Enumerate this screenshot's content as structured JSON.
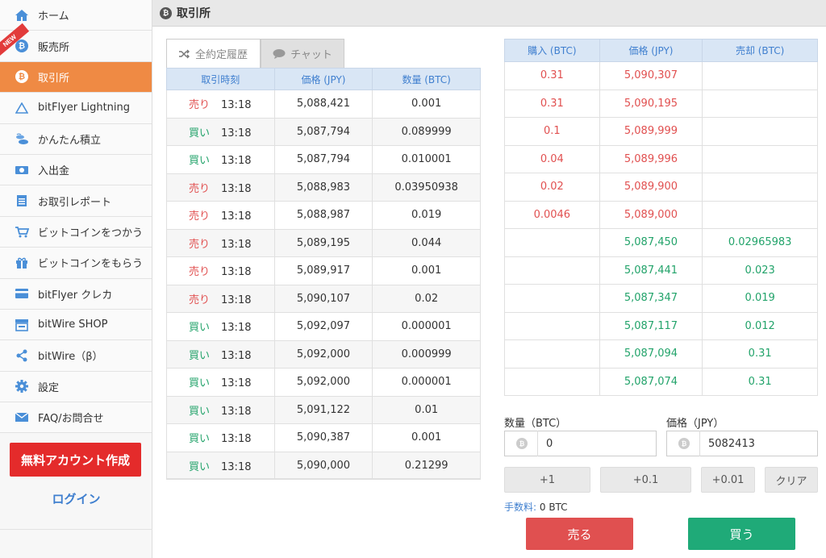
{
  "sidebar": {
    "new_badge": "NEW",
    "items": [
      {
        "label": "ホーム",
        "icon": "home-icon"
      },
      {
        "label": "販売所",
        "icon": "bitcoin-icon"
      },
      {
        "label": "取引所",
        "icon": "bitcoin-icon"
      },
      {
        "label": "bitFlyer Lightning",
        "icon": "lightning-icon"
      },
      {
        "label": "かんたん積立",
        "icon": "coins-icon"
      },
      {
        "label": "入出金",
        "icon": "money-icon"
      },
      {
        "label": "お取引レポート",
        "icon": "report-icon"
      },
      {
        "label": "ビットコインをつかう",
        "icon": "cart-icon"
      },
      {
        "label": "ビットコインをもらう",
        "icon": "gift-icon"
      },
      {
        "label": "bitFlyer クレカ",
        "icon": "card-icon"
      },
      {
        "label": "bitWire SHOP",
        "icon": "shop-icon"
      },
      {
        "label": "bitWire（β）",
        "icon": "share-icon"
      },
      {
        "label": "設定",
        "icon": "gear-icon"
      },
      {
        "label": "FAQ/お問合せ",
        "icon": "mail-icon"
      }
    ],
    "signup_label": "無料アカウント作成",
    "login_label": "ログイン"
  },
  "header": {
    "title": "取引所"
  },
  "tabs": {
    "history": "全約定履歴",
    "chat": "チャット"
  },
  "trades": {
    "headers": [
      "取引時刻",
      "価格 (JPY)",
      "数量 (BTC)"
    ],
    "rows": [
      {
        "side": "売り",
        "type": "sell",
        "time": "13:18",
        "price": "5,088,421",
        "qty": "0.001"
      },
      {
        "side": "買い",
        "type": "buy",
        "time": "13:18",
        "price": "5,087,794",
        "qty": "0.089999"
      },
      {
        "side": "買い",
        "type": "buy",
        "time": "13:18",
        "price": "5,087,794",
        "qty": "0.010001"
      },
      {
        "side": "売り",
        "type": "sell",
        "time": "13:18",
        "price": "5,088,983",
        "qty": "0.03950938"
      },
      {
        "side": "売り",
        "type": "sell",
        "time": "13:18",
        "price": "5,088,987",
        "qty": "0.019"
      },
      {
        "side": "売り",
        "type": "sell",
        "time": "13:18",
        "price": "5,089,195",
        "qty": "0.044"
      },
      {
        "side": "売り",
        "type": "sell",
        "time": "13:18",
        "price": "5,089,917",
        "qty": "0.001"
      },
      {
        "side": "売り",
        "type": "sell",
        "time": "13:18",
        "price": "5,090,107",
        "qty": "0.02"
      },
      {
        "side": "買い",
        "type": "buy",
        "time": "13:18",
        "price": "5,092,097",
        "qty": "0.000001"
      },
      {
        "side": "買い",
        "type": "buy",
        "time": "13:18",
        "price": "5,092,000",
        "qty": "0.000999"
      },
      {
        "side": "買い",
        "type": "buy",
        "time": "13:18",
        "price": "5,092,000",
        "qty": "0.000001"
      },
      {
        "side": "買い",
        "type": "buy",
        "time": "13:18",
        "price": "5,091,122",
        "qty": "0.01"
      },
      {
        "side": "買い",
        "type": "buy",
        "time": "13:18",
        "price": "5,090,387",
        "qty": "0.001"
      },
      {
        "side": "買い",
        "type": "buy",
        "time": "13:18",
        "price": "5,090,000",
        "qty": "0.21299"
      }
    ]
  },
  "orderbook": {
    "headers": [
      "購入 (BTC)",
      "価格 (JPY)",
      "売却 (BTC)"
    ],
    "asks": [
      {
        "buy": "0.31",
        "price": "5,090,307"
      },
      {
        "buy": "0.31",
        "price": "5,090,195"
      },
      {
        "buy": "0.1",
        "price": "5,089,999"
      },
      {
        "buy": "0.04",
        "price": "5,089,996"
      },
      {
        "buy": "0.02",
        "price": "5,089,900"
      },
      {
        "buy": "0.0046",
        "price": "5,089,000"
      }
    ],
    "bids": [
      {
        "price": "5,087,450",
        "sell": "0.02965983"
      },
      {
        "price": "5,087,441",
        "sell": "0.023"
      },
      {
        "price": "5,087,347",
        "sell": "0.019"
      },
      {
        "price": "5,087,117",
        "sell": "0.012"
      },
      {
        "price": "5,087,094",
        "sell": "0.31"
      },
      {
        "price": "5,087,074",
        "sell": "0.31"
      }
    ]
  },
  "form": {
    "qty_label": "数量（BTC）",
    "qty_value": "0",
    "price_label": "価格（JPY）",
    "price_value": "5082413",
    "quick": [
      "+1",
      "+0.1",
      "+0.01",
      "クリア"
    ],
    "fee_label": "手数料:",
    "fee_value": "0 BTC",
    "sell_label": "売る",
    "buy_label": "買う"
  },
  "colors": {
    "accent": "#ef8a44",
    "sell": "#e05050",
    "buy": "#1faa78",
    "link": "#3f7fcf"
  }
}
